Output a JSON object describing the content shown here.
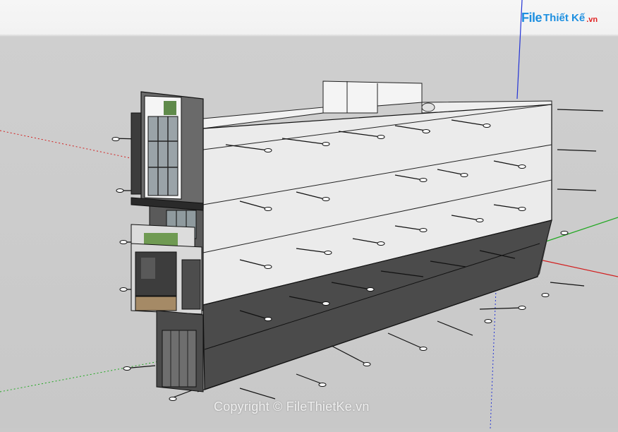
{
  "watermark": {
    "logo": {
      "file": "File",
      "rest": "Thiết Kế",
      "tld": ".vn"
    },
    "copyright": "Copyright © FileThietKe.vn"
  },
  "scene": {
    "background_sky": "#f3f3f3",
    "background_ground": "#c8c8c8",
    "wall_light": "#ececec",
    "wall_dark": "#4a4a4a",
    "axis_red": "#d21f1f",
    "axis_green": "#22a822",
    "axis_blue": "#2434d6"
  }
}
